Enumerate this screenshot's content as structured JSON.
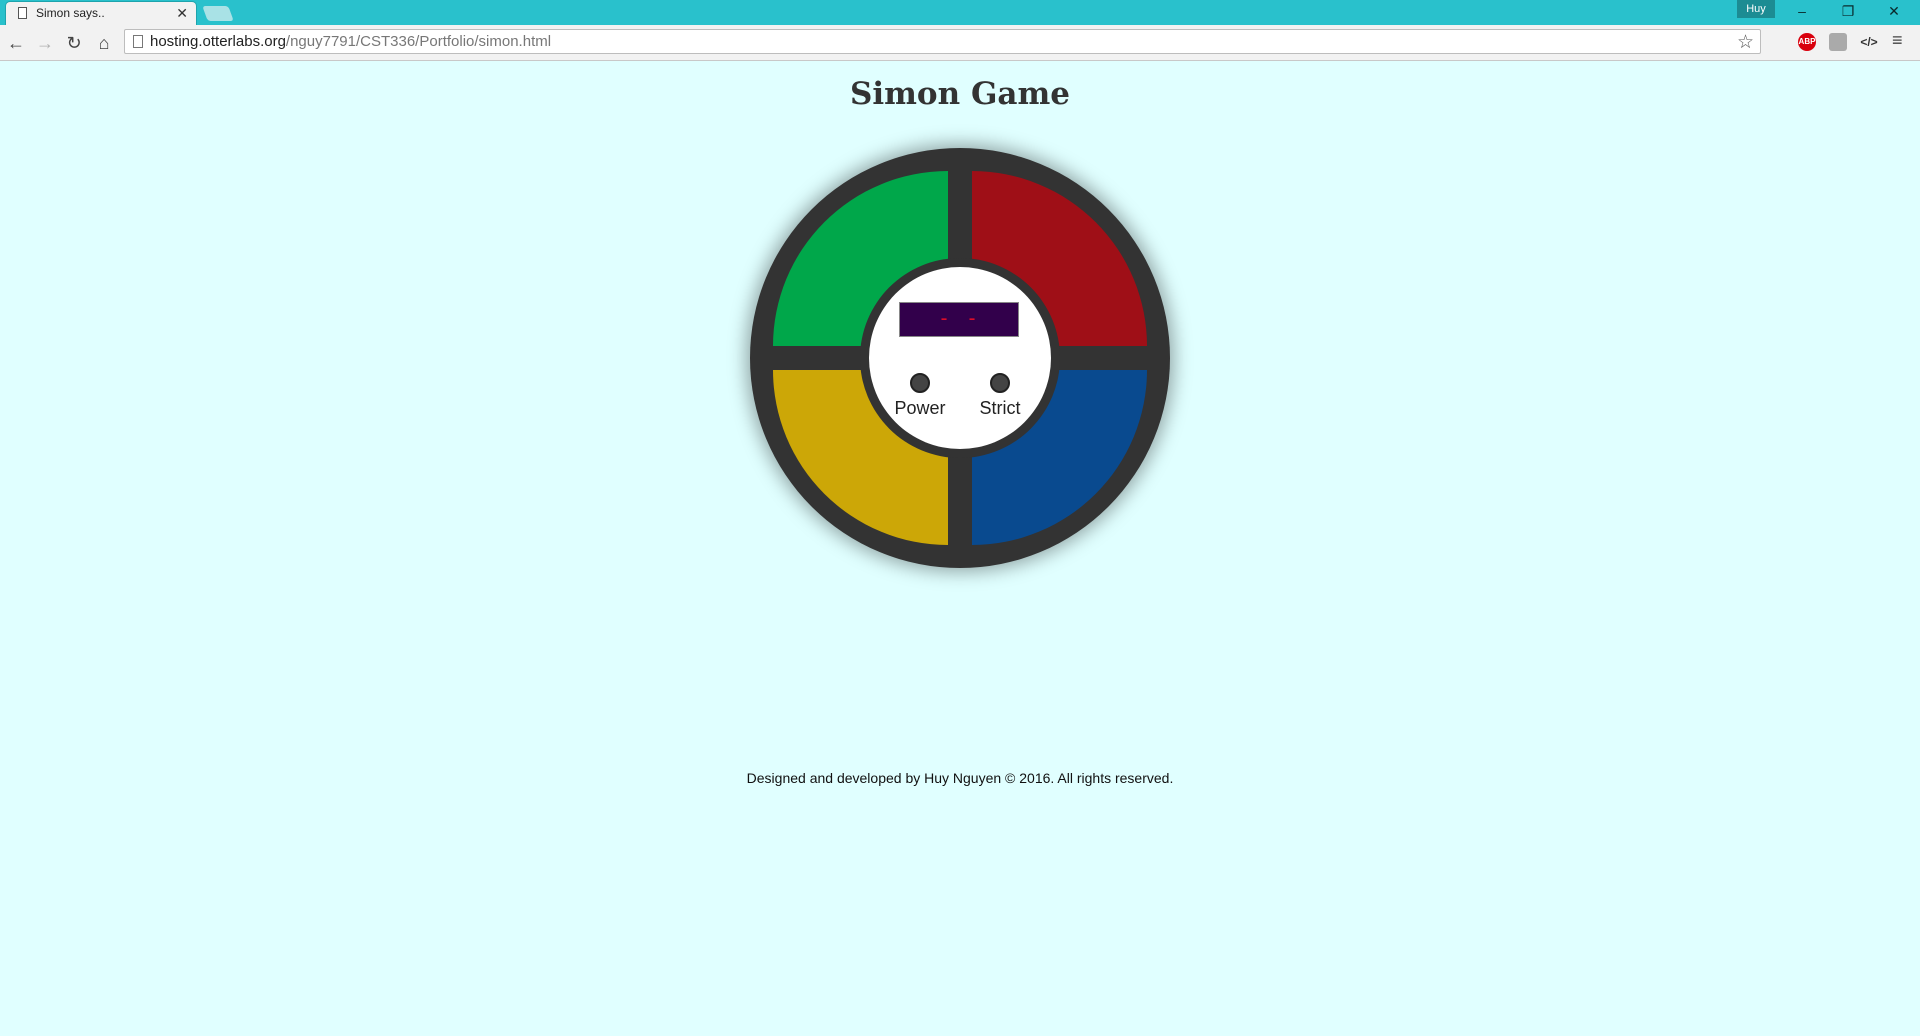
{
  "browser": {
    "tab_title": "Simon says..",
    "profile_name": "Huy",
    "url_host": "hosting.otterlabs.org",
    "url_path": "/nguy7791/CST336/Portfolio/simon.html",
    "ext_abp": "ABP",
    "ext_code": "</>"
  },
  "page": {
    "title": "Simon Game",
    "counter_display": "- -",
    "power_label": "Power",
    "strict_label": "Strict",
    "footer": "Designed and developed by Huy Nguyen © 2016. All rights reserved."
  },
  "colors": {
    "background": "#e0ffff",
    "pad_green": "#00a74a",
    "pad_red": "#9f0f17",
    "pad_yellow": "#cca707",
    "pad_blue": "#094a8f",
    "body": "#333333"
  }
}
